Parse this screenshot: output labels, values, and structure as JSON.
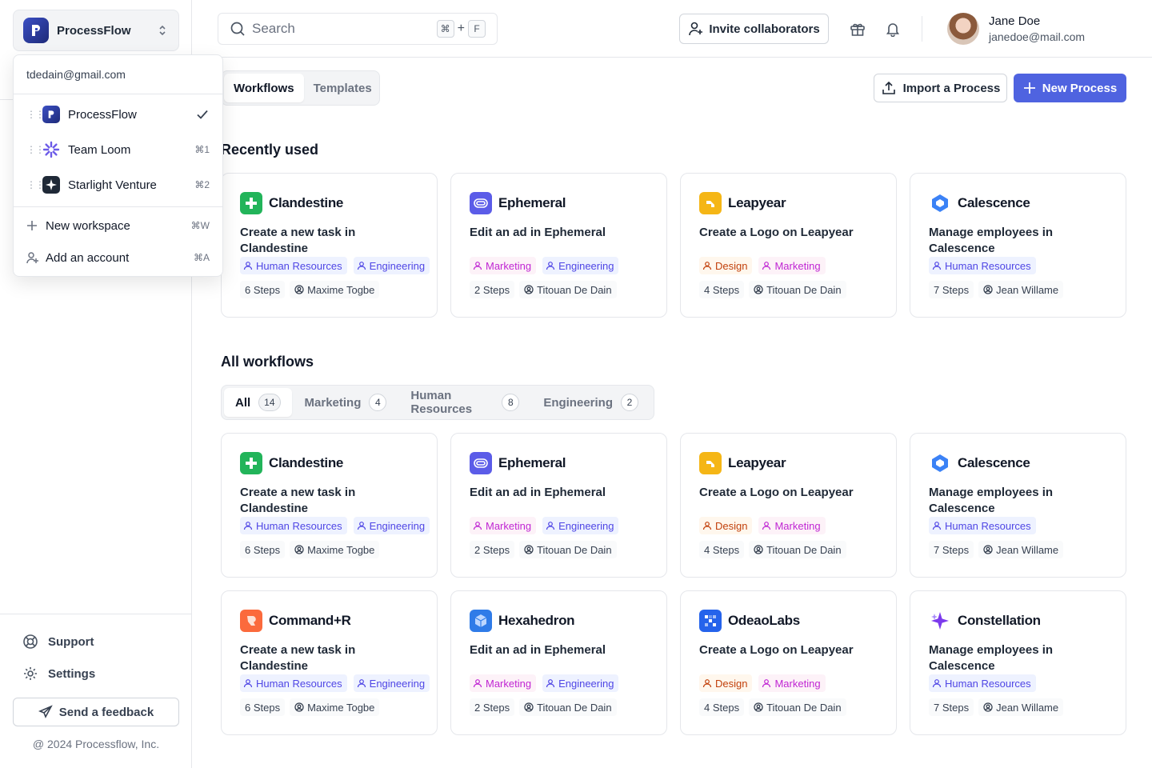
{
  "workspace": {
    "current": "ProcessFlow"
  },
  "dropdown": {
    "email": "tdedain@gmail.com",
    "workspaces": [
      {
        "name": "ProcessFlow",
        "shortcut": "",
        "selected": true
      },
      {
        "name": "Team Loom",
        "shortcut": "⌘1",
        "selected": false
      },
      {
        "name": "Starlight Venture",
        "shortcut": "⌘2",
        "selected": false
      }
    ],
    "actions": [
      {
        "label": "New workspace",
        "shortcut": "⌘W"
      },
      {
        "label": "Add an account",
        "shortcut": "⌘A"
      }
    ]
  },
  "sidebar": {
    "support": "Support",
    "settings": "Settings",
    "feedback": "Send a feedback",
    "copyright": "@ 2024 Processflow, Inc."
  },
  "topbar": {
    "search_placeholder": "Search",
    "kbd_cmd": "⌘",
    "kbd_plus": "+",
    "kbd_key": "F",
    "invite": "Invite collaborators",
    "user_name": "Jane Doe",
    "user_email": "janedoe@mail.com"
  },
  "tabs": [
    {
      "label": "Workflows",
      "active": true
    },
    {
      "label": "Templates",
      "active": false
    }
  ],
  "actions": {
    "import": "Import a Process",
    "new": "New Process"
  },
  "sections": {
    "recent": "Recently used",
    "all": "All workflows"
  },
  "filters": [
    {
      "label": "All",
      "count": "14"
    },
    {
      "label": "Marketing",
      "count": "4"
    },
    {
      "label": "Human Resources",
      "count": "8"
    },
    {
      "label": "Engineering",
      "count": "2"
    }
  ],
  "recent": [
    {
      "brand": "Clandestine",
      "desc": "Create a new task in Clandestine",
      "tags": [
        "Human Resources",
        "Engineering"
      ],
      "steps": "6 Steps",
      "owner": "Maxime Togbe"
    },
    {
      "brand": "Ephemeral",
      "desc": "Edit an ad in Ephemeral",
      "tags": [
        "Marketing",
        "Engineering"
      ],
      "steps": "2 Steps",
      "owner": "Titouan De Dain"
    },
    {
      "brand": "Leapyear",
      "desc": "Create a Logo on Leapyear",
      "tags": [
        "Design",
        "Marketing"
      ],
      "steps": "4 Steps",
      "owner": "Titouan De Dain"
    },
    {
      "brand": "Calescence",
      "desc": "Manage employees in Calescence",
      "tags": [
        "Human Resources"
      ],
      "steps": "7 Steps",
      "owner": "Jean Willame"
    }
  ],
  "all": [
    {
      "brand": "Clandestine",
      "desc": "Create a new task in Clandestine",
      "tags": [
        "Human Resources",
        "Engineering"
      ],
      "steps": "6 Steps",
      "owner": "Maxime Togbe"
    },
    {
      "brand": "Ephemeral",
      "desc": "Edit an ad in Ephemeral",
      "tags": [
        "Marketing",
        "Engineering"
      ],
      "steps": "2 Steps",
      "owner": "Titouan De Dain"
    },
    {
      "brand": "Leapyear",
      "desc": "Create a Logo on Leapyear",
      "tags": [
        "Design",
        "Marketing"
      ],
      "steps": "4 Steps",
      "owner": "Titouan De Dain"
    },
    {
      "brand": "Calescence",
      "desc": "Manage employees in Calescence",
      "tags": [
        "Human Resources"
      ],
      "steps": "7 Steps",
      "owner": "Jean Willame"
    },
    {
      "brand": "Command+R",
      "desc": "Create a new task in Clandestine",
      "tags": [
        "Human Resources",
        "Engineering"
      ],
      "steps": "6 Steps",
      "owner": "Maxime Togbe"
    },
    {
      "brand": "Hexahedron",
      "desc": "Edit an ad in Ephemeral",
      "tags": [
        "Marketing",
        "Engineering"
      ],
      "steps": "2 Steps",
      "owner": "Titouan De Dain"
    },
    {
      "brand": "OdeaoLabs",
      "desc": "Create a Logo on Leapyear",
      "tags": [
        "Design",
        "Marketing"
      ],
      "steps": "4 Steps",
      "owner": "Titouan De Dain"
    },
    {
      "brand": "Constellation",
      "desc": "Manage employees in Calescence",
      "tags": [
        "Human Resources"
      ],
      "steps": "7 Steps",
      "owner": "Jean Willame"
    }
  ]
}
